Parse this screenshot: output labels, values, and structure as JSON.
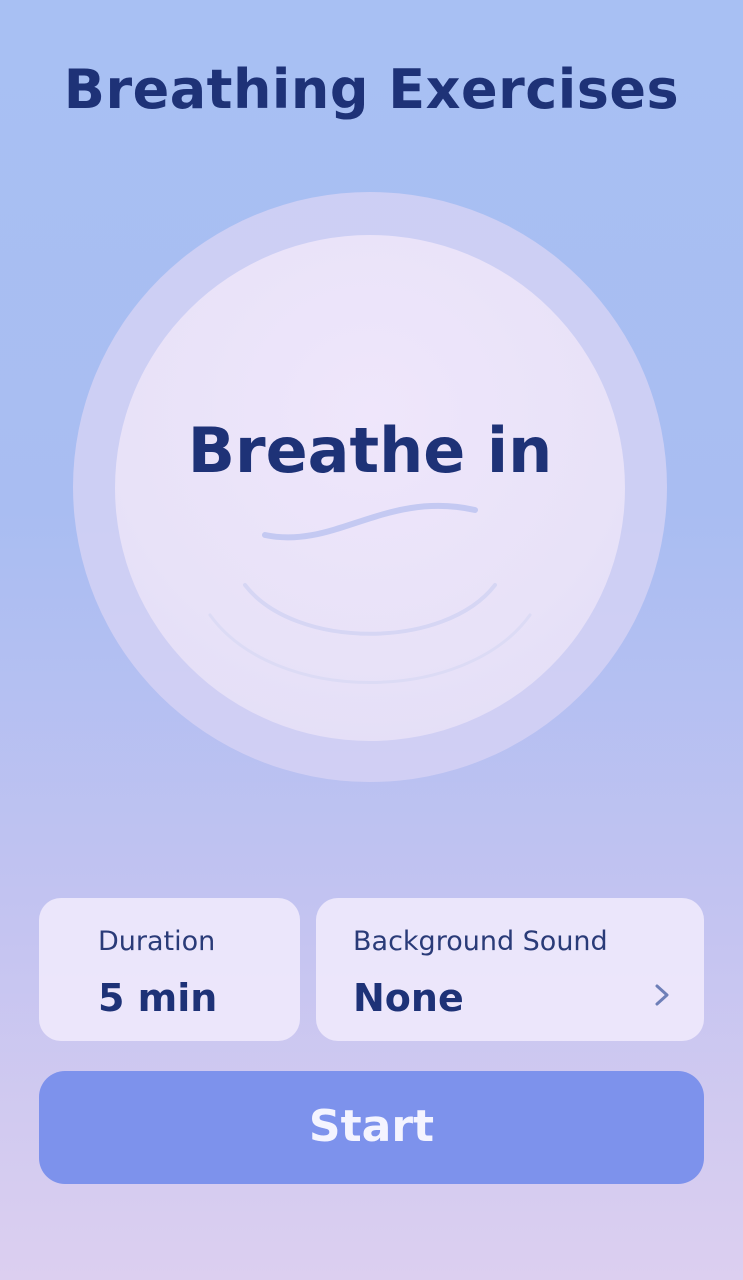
{
  "header": {
    "title": "Breathing Exercises"
  },
  "breathing_circle": {
    "instruction": "Breathe in"
  },
  "settings": {
    "duration": {
      "label": "Duration",
      "value": "5 min"
    },
    "background_sound": {
      "label": "Background Sound",
      "value": "None",
      "icon": "chevron-right-icon"
    }
  },
  "actions": {
    "start_label": "Start"
  },
  "colors": {
    "title_text": "#1e3277",
    "start_button": "#7d92ec",
    "card_background": "#f0eafc",
    "background_top": "#a8c0f3",
    "background_bottom": "#dccff0"
  }
}
